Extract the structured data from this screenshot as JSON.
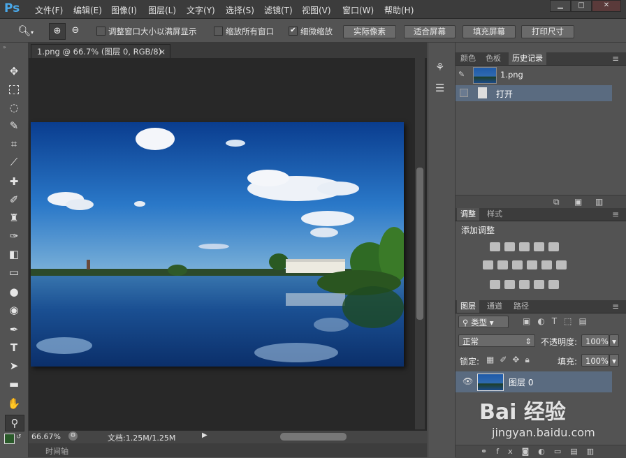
{
  "app": {
    "logo": "Ps",
    "menu": [
      "文件(F)",
      "编辑(E)",
      "图像(I)",
      "图层(L)",
      "文字(Y)",
      "选择(S)",
      "滤镜(T)",
      "视图(V)",
      "窗口(W)",
      "帮助(H)"
    ],
    "window_controls": [
      "▁",
      "□",
      "✕"
    ]
  },
  "options_bar": {
    "checkbox_resize_window": "调整窗口大小以满屏显示",
    "checkbox_zoom_all": "缩放所有窗口",
    "checkbox_scrubby": "细微缩放",
    "scrubby_checked": true,
    "btn_actual_pixels": "实际像素",
    "btn_fit_screen": "适合屏幕",
    "btn_fill_screen": "填充屏幕",
    "btn_print_size": "打印尺寸"
  },
  "document": {
    "tab_title": "1.png @ 66.7% (图层 0, RGB/8)",
    "tab_close": "×",
    "zoom": "66.67%",
    "doc_size": "文档:1.25M/1.25M"
  },
  "timeline": {
    "label": "时间轴"
  },
  "history_panel": {
    "tabs": [
      "颜色",
      "色板",
      "历史记录"
    ],
    "active_tab": 2,
    "snapshot_name": "1.png",
    "steps": [
      "打开"
    ]
  },
  "adjustments_panel": {
    "tabs": [
      "调整",
      "样式"
    ],
    "active_tab": 0,
    "title": "添加调整"
  },
  "layers_panel": {
    "tabs": [
      "图层",
      "通道",
      "路径"
    ],
    "active_tab": 0,
    "filter_kind": "类型",
    "blend_mode": "正常",
    "opacity_label": "不透明度:",
    "opacity": "100%",
    "lock_label": "锁定:",
    "fill_label": "填充:",
    "fill": "100%",
    "layers": [
      {
        "name": "图层 0",
        "visible": true
      }
    ]
  },
  "watermark": {
    "brand": "Bai 经验",
    "url": "jingyan.baidu.com"
  },
  "colors": {
    "accent": "#4aa8e8",
    "selected_row": "#5a6b80",
    "panel": "#535353"
  }
}
